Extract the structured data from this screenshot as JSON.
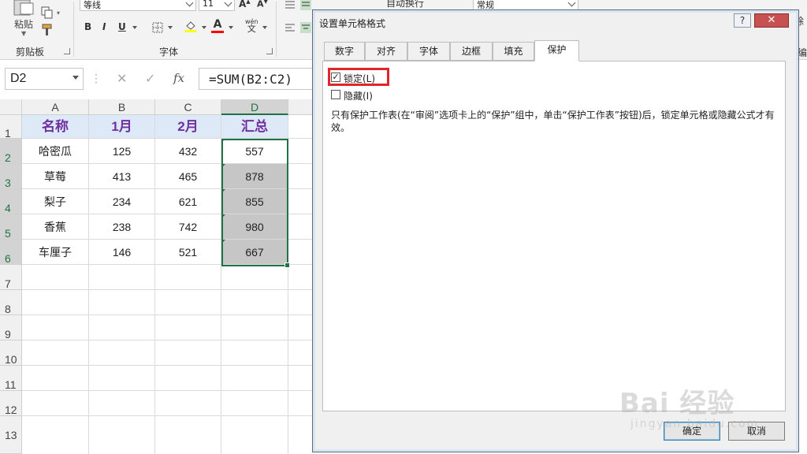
{
  "ribbon": {
    "clipboard": {
      "paste_label": "粘贴",
      "group_label": "剪贴板"
    },
    "font": {
      "font_name": "等线",
      "font_size": "11",
      "bold": "B",
      "italic": "I",
      "underline": "U",
      "phonetic": "wén",
      "phonetic_char": "文",
      "group_label": "字体"
    },
    "alignment": {
      "wrap_text": "自动换行"
    },
    "number": {
      "format": "常规"
    },
    "right_partial": "除",
    "right_partial2": "编"
  },
  "formula_bar": {
    "name_box": "D2",
    "cancel": "✕",
    "enter": "✓",
    "fx": "fx",
    "formula": "=SUM(B2:C2)"
  },
  "sheet": {
    "columns": [
      "A",
      "B",
      "C",
      "D"
    ],
    "rows": [
      "1",
      "2",
      "3",
      "4",
      "5",
      "6",
      "7",
      "8",
      "9",
      "10",
      "11",
      "12",
      "13"
    ],
    "headers": [
      "名称",
      "1月",
      "2月",
      "汇总"
    ],
    "data": [
      [
        "哈密瓜",
        "125",
        "432",
        "557"
      ],
      [
        "草莓",
        "413",
        "465",
        "878"
      ],
      [
        "梨子",
        "234",
        "621",
        "855"
      ],
      [
        "香蕉",
        "238",
        "742",
        "980"
      ],
      [
        "车厘子",
        "146",
        "521",
        "667"
      ]
    ]
  },
  "dialog": {
    "title": "设置单元格格式",
    "help": "?",
    "close": "✕",
    "tabs": [
      "数字",
      "对齐",
      "字体",
      "边框",
      "填充",
      "保护"
    ],
    "active_tab": "保护",
    "locked_label": "锁定(L)",
    "locked_checked": true,
    "check_mark": "✓",
    "hidden_label": "隐藏(I)",
    "hidden_checked": false,
    "description": "只有保护工作表(在“审阅”选项卡上的“保护”组中，单击“保护工作表”按钮)后，锁定单元格或隐藏公式才有效。",
    "ok": "确定",
    "cancel": "取消"
  },
  "watermark": {
    "text": "Bai 经验",
    "sub": "jingyan.baidu.com"
  },
  "colors": {
    "excel_green": "#217346",
    "header_fill": "#dde9f6",
    "header_text": "#7030a0",
    "selected_fill": "#c6c6c6",
    "highlight_red": "#e0262b"
  }
}
